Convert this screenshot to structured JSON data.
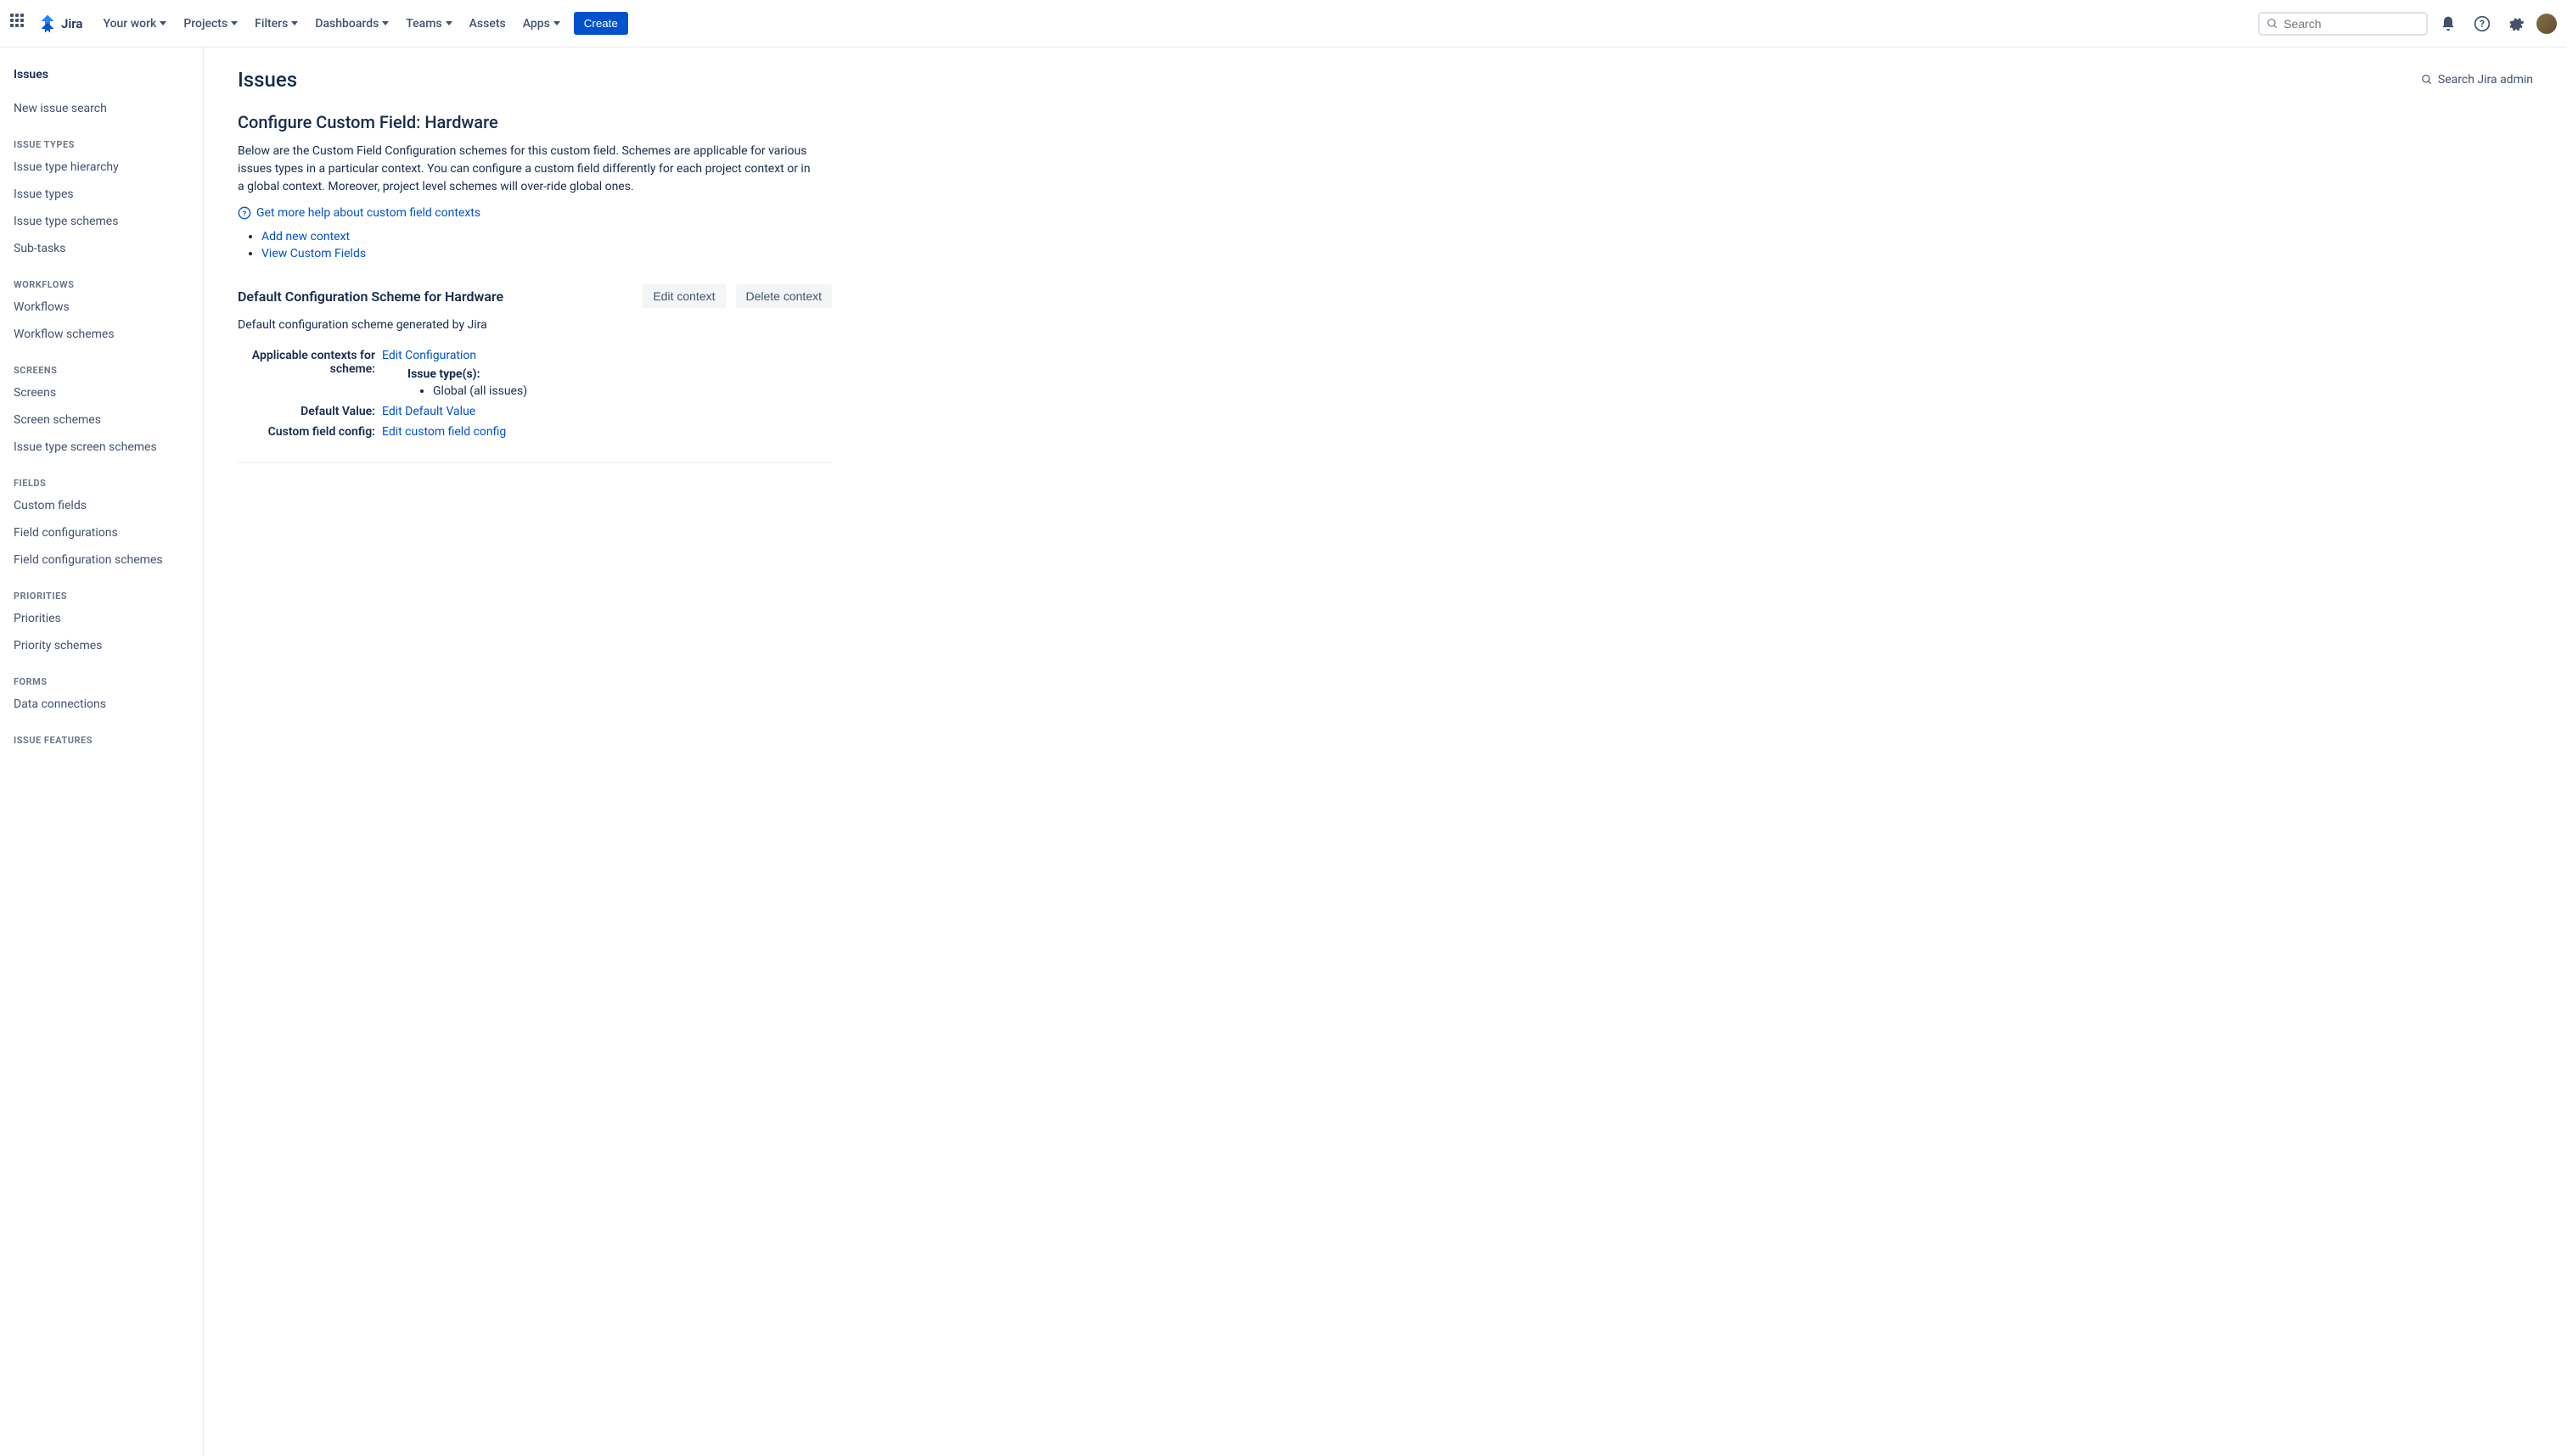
{
  "topnav": {
    "logo_text": "Jira",
    "items": [
      {
        "label": "Your work",
        "dropdown": true
      },
      {
        "label": "Projects",
        "dropdown": true
      },
      {
        "label": "Filters",
        "dropdown": true
      },
      {
        "label": "Dashboards",
        "dropdown": true
      },
      {
        "label": "Teams",
        "dropdown": true
      },
      {
        "label": "Assets",
        "dropdown": false
      },
      {
        "label": "Apps",
        "dropdown": true
      }
    ],
    "create_label": "Create",
    "search_placeholder": "Search"
  },
  "sidebar": {
    "title": "Issues",
    "top_items": [
      "New issue search"
    ],
    "sections": [
      {
        "heading": "Issue Types",
        "items": [
          "Issue type hierarchy",
          "Issue types",
          "Issue type schemes",
          "Sub-tasks"
        ]
      },
      {
        "heading": "Workflows",
        "items": [
          "Workflows",
          "Workflow schemes"
        ]
      },
      {
        "heading": "Screens",
        "items": [
          "Screens",
          "Screen schemes",
          "Issue type screen schemes"
        ]
      },
      {
        "heading": "Fields",
        "items": [
          "Custom fields",
          "Field configurations",
          "Field configuration schemes"
        ]
      },
      {
        "heading": "Priorities",
        "items": [
          "Priorities",
          "Priority schemes"
        ]
      },
      {
        "heading": "Forms",
        "items": [
          "Data connections"
        ]
      },
      {
        "heading": "Issue Features",
        "items": []
      }
    ]
  },
  "main": {
    "page_title": "Issues",
    "search_admin_label": "Search Jira admin",
    "configure_title": "Configure Custom Field: Hardware",
    "configure_desc": "Below are the Custom Field Configuration schemes for this custom field. Schemes are applicable for various issues types in a particular context. You can configure a custom field differently for each project context or in a global context. Moreover, project level schemes will over-ride global ones.",
    "help_link": "Get more help about custom field contexts",
    "action_links": [
      "Add new context",
      "View Custom Fields"
    ],
    "scheme": {
      "title": "Default Configuration Scheme for Hardware",
      "edit_label": "Edit context",
      "delete_label": "Delete context",
      "desc": "Default configuration scheme generated by Jira",
      "rows": {
        "applicable_label": "Applicable contexts for scheme:",
        "applicable_link": "Edit Configuration",
        "issue_types_label": "Issue type(s):",
        "issue_types_value": "Global (all issues)",
        "default_value_label": "Default Value:",
        "default_value_link": "Edit Default Value",
        "custom_config_label": "Custom field config:",
        "custom_config_link": "Edit custom field config"
      }
    }
  }
}
